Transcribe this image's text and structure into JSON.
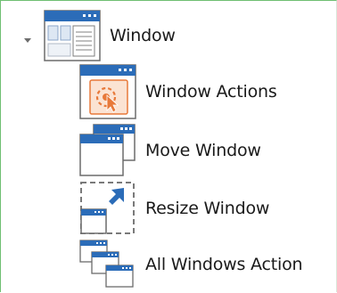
{
  "tree": {
    "root": {
      "label": "Window",
      "expanded": true,
      "icon": "window-form-icon"
    },
    "children": [
      {
        "label": "Window Actions",
        "icon": "window-actions-icon"
      },
      {
        "label": "Move Window",
        "icon": "move-window-icon"
      },
      {
        "label": "Resize Window",
        "icon": "resize-window-icon"
      },
      {
        "label": "All Windows Action",
        "icon": "all-windows-icon"
      }
    ]
  },
  "colors": {
    "window_title_bar": "#2b6cb8",
    "window_frame": "#4a4a4a",
    "accent_orange": "#e8793a",
    "panel_border": "#6fbf73",
    "text": "#1a1a1a"
  }
}
